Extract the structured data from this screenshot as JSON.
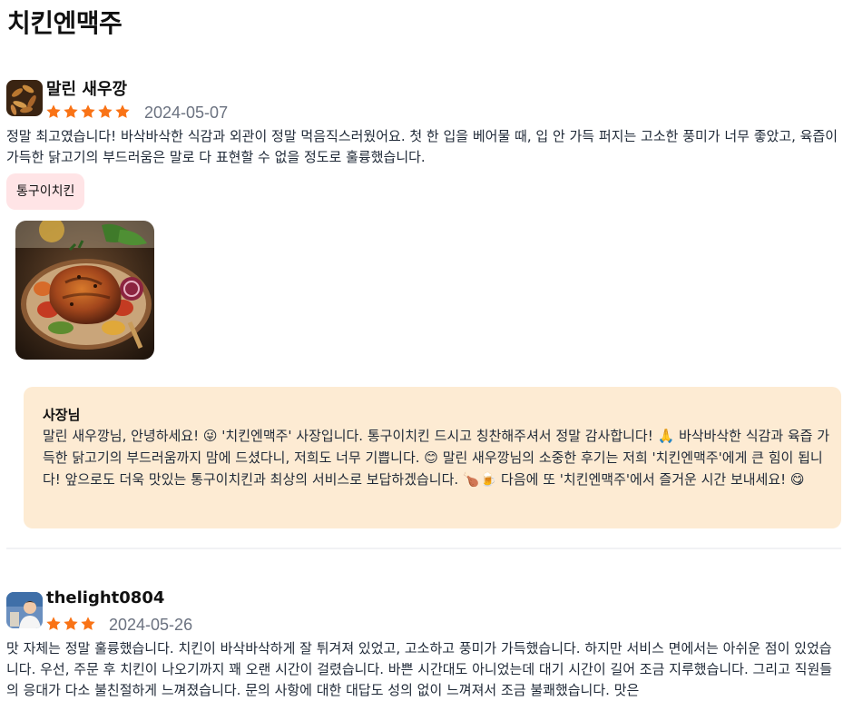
{
  "store": {
    "name": "치킨엔맥주"
  },
  "reviews": [
    {
      "username": "말린 새우깡",
      "rating": 5,
      "date": "2024-05-07",
      "text": "정말 최고였습니다! 바삭바삭한 식감과 외관이 정말 먹음직스러웠어요. 첫 한 입을 베어물 때, 입 안 가득 퍼지는 고소한 풍미가 너무 좋았고, 육즙이 가득한 닭고기의 부드러움은 말로 다 표현할 수 없을 정도로 훌륭했습니다.",
      "menu_tag": "통구이치킨",
      "reply": {
        "author": "사장님",
        "text": "말린 새우깡님, 안녕하세요! 😜 '치킨엔맥주' 사장입니다. 통구이치킨 드시고 칭찬해주셔서 정말 감사합니다! 🙏 바삭바삭한 식감과 육즙 가득한 닭고기의 부드러움까지 맘에 드셨다니, 저희도 너무 기쁩니다. 😊 말린 새우깡님의 소중한 후기는 저희 '치킨엔맥주'에게 큰 힘이 됩니다! 앞으로도 더욱 맛있는 통구이치킨과 최상의 서비스로 보답하겠습니다. 🍗🍺 다음에 또 '치킨엔맥주'에서 즐거운 시간 보내세요! 😋"
      }
    },
    {
      "username": "thelight0804",
      "rating": 3,
      "date": "2024-05-26",
      "text": "맛 자체는 정말 훌륭했습니다. 치킨이 바삭바삭하게 잘 튀겨져 있었고, 고소하고 풍미가 가득했습니다. 하지만 서비스 면에서는 아쉬운 점이 있었습니다. 우선, 주문 후 치킨이 나오기까지 꽤 오랜 시간이 걸렸습니다. 바쁜 시간대도 아니었는데 대기 시간이 길어 조금 지루했습니다. 그리고 직원들의 응대가 다소 불친절하게 느껴졌습니다. 문의 사항에 대한 대답도 성의 없이 느껴져서 조금 불쾌했습니다. 맛은"
    }
  ],
  "colors": {
    "star": "#f97316",
    "tag_bg": "#ffe4e6",
    "reply_bg": "#fdebd3",
    "date": "#6b7280"
  }
}
